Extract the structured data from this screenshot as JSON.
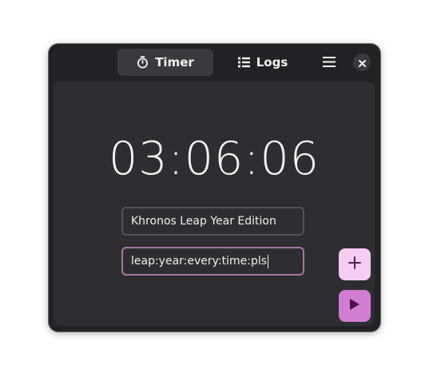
{
  "header": {
    "tabs": [
      {
        "label": "Timer",
        "icon": "stopwatch-icon",
        "active": true
      },
      {
        "label": "Logs",
        "icon": "list-icon",
        "active": false
      }
    ],
    "menu_icon": "hamburger-menu-icon",
    "close_icon": "close-icon"
  },
  "timer": {
    "time": "03:06:06"
  },
  "fields": {
    "name_value": "Khronos Leap Year Edition",
    "tags_value": "leap:year:every:time:pls"
  },
  "actions": {
    "add_icon": "plus-icon",
    "play_icon": "play-icon"
  },
  "colors": {
    "window_bg": "#222226",
    "content_bg": "#2e2d31",
    "accent_light": "#f5cdf3",
    "accent": "#d17dd1",
    "focus_border": "#a874a6"
  }
}
